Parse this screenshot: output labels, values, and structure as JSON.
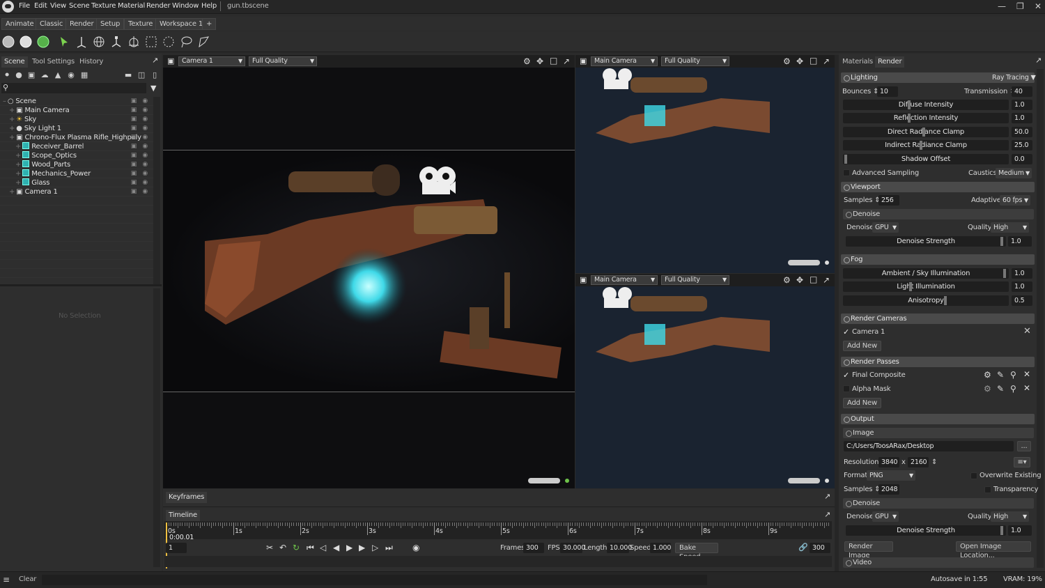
{
  "app": {
    "file_name": "gun.tbscene"
  },
  "menu": [
    "File",
    "Edit",
    "View",
    "Scene",
    "Texture",
    "Material",
    "Render",
    "Window",
    "Help"
  ],
  "workspace_tabs": [
    "Animate",
    "Classic",
    "Render",
    "Setup",
    "Texture",
    "Workspace 1",
    "+"
  ],
  "left_panel": {
    "tabs": [
      "Scene",
      "Tool Settings",
      "History"
    ],
    "tree": [
      {
        "label": "Scene",
        "icon": "scene-icon"
      },
      {
        "label": "Main Camera",
        "icon": "camera-icon"
      },
      {
        "label": "Sky",
        "icon": "sky-icon"
      },
      {
        "label": "Sky Light 1",
        "icon": "light-icon"
      },
      {
        "label": "Chrono-Flux Plasma Rifle_Highpoly",
        "icon": "group-icon"
      },
      {
        "label": "Receiver_Barrel",
        "icon": "mesh-icon"
      },
      {
        "label": "Scope_Optics",
        "icon": "mesh-icon"
      },
      {
        "label": "Wood_Parts",
        "icon": "mesh-icon"
      },
      {
        "label": "Mechanics_Power",
        "icon": "mesh-icon"
      },
      {
        "label": "Glass",
        "icon": "mesh-icon"
      },
      {
        "label": "Camera 1",
        "icon": "camera-icon"
      }
    ],
    "no_selection": "No Selection"
  },
  "viewport_main": {
    "camera": "Camera 1",
    "quality": "Full Quality"
  },
  "viewport_top": {
    "camera": "Main Camera",
    "quality": "Full Quality"
  },
  "viewport_bottom": {
    "camera": "Main Camera",
    "quality": "Full Quality"
  },
  "timeline": {
    "keyframes_tab": "Keyframes",
    "timeline_tab": "Timeline",
    "ruler": [
      "0s",
      "1s",
      "2s",
      "3s",
      "4s",
      "5s",
      "6s",
      "7s",
      "8s",
      "9s"
    ],
    "current_time": "0:00.01",
    "current_frame": "1",
    "frames_label": "Frames",
    "frames": "300",
    "fps_label": "FPS",
    "fps": "30.000",
    "length_label": "Length",
    "length": "10.000",
    "speed_label": "Speed",
    "speed": "1.000",
    "bake_speed": "Bake Speed",
    "end_frame": "300"
  },
  "right_panel": {
    "tabs": [
      "Materials",
      "Render"
    ],
    "lighting": {
      "title": "Lighting",
      "mode": "Ray Tracing",
      "bounces_label": "Bounces",
      "bounces": "10",
      "transmission_label": "Transmission",
      "transmission": "40",
      "sliders": [
        {
          "label": "Diffuse Intensity",
          "value": "1.0"
        },
        {
          "label": "Reflection Intensity",
          "value": "1.0"
        },
        {
          "label": "Direct Radiance Clamp",
          "value": "50.0"
        },
        {
          "label": "Indirect Radiance Clamp",
          "value": "25.0"
        },
        {
          "label": "Shadow Offset",
          "value": "0.0"
        }
      ],
      "advanced_sampling": "Advanced Sampling",
      "caustics_label": "Caustics",
      "caustics": "Medium"
    },
    "viewport": {
      "title": "Viewport",
      "samples_label": "Samples",
      "samples": "256",
      "adaptive_label": "Adaptive",
      "adaptive": "60 fps",
      "denoise_title": "Denoise",
      "denoise_label": "Denoise",
      "denoise": "GPU",
      "quality_label": "Quality",
      "quality": "High",
      "strength_label": "Denoise Strength",
      "strength": "1.0"
    },
    "fog": {
      "title": "Fog",
      "sliders": [
        {
          "label": "Ambient / Sky Illumination",
          "value": "1.0"
        },
        {
          "label": "Light Illumination",
          "value": "1.0"
        },
        {
          "label": "Anisotropy",
          "value": "0.5"
        }
      ]
    },
    "render_cameras": {
      "title": "Render Cameras",
      "camera": "Camera 1",
      "add_new": "Add New"
    },
    "render_passes": {
      "title": "Render Passes",
      "passes": [
        "Final Composite",
        "Alpha Mask"
      ],
      "add_new": "Add New"
    },
    "output": {
      "title": "Output",
      "image_title": "Image",
      "path": "C:/Users/ToosARax/Desktop",
      "browse": "...",
      "resolution_label": "Resolution:",
      "width": "3840",
      "x": "x",
      "height": "2160",
      "format_label": "Format",
      "format": "PNG",
      "overwrite": "Overwrite Existing",
      "samples_label": "Samples",
      "samples": "2048",
      "transparency": "Transparency",
      "denoise_title": "Denoise",
      "denoise_label": "Denoise",
      "denoise": "GPU",
      "quality_label": "Quality",
      "quality": "High",
      "strength_label": "Denoise Strength",
      "strength": "1.0",
      "render_image": "Render Image",
      "open_location": "Open Image Location...",
      "video_title": "Video"
    }
  },
  "status": {
    "clear": "Clear",
    "autosave": "Autosave in 1:55",
    "vram": "VRAM: 19%"
  }
}
